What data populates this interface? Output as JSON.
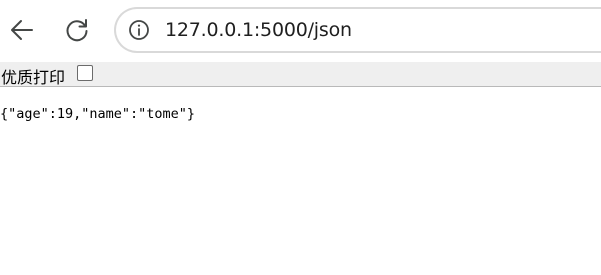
{
  "browser": {
    "back_icon": "back-arrow-icon",
    "reload_icon": "reload-icon",
    "site_info_icon": "info-icon",
    "url": "127.0.0.1:5000/json"
  },
  "print_bar": {
    "label": "优质打印",
    "checkbox_checked": false
  },
  "page": {
    "body_text": "{\"age\":19,\"name\":\"tome\"}"
  }
}
